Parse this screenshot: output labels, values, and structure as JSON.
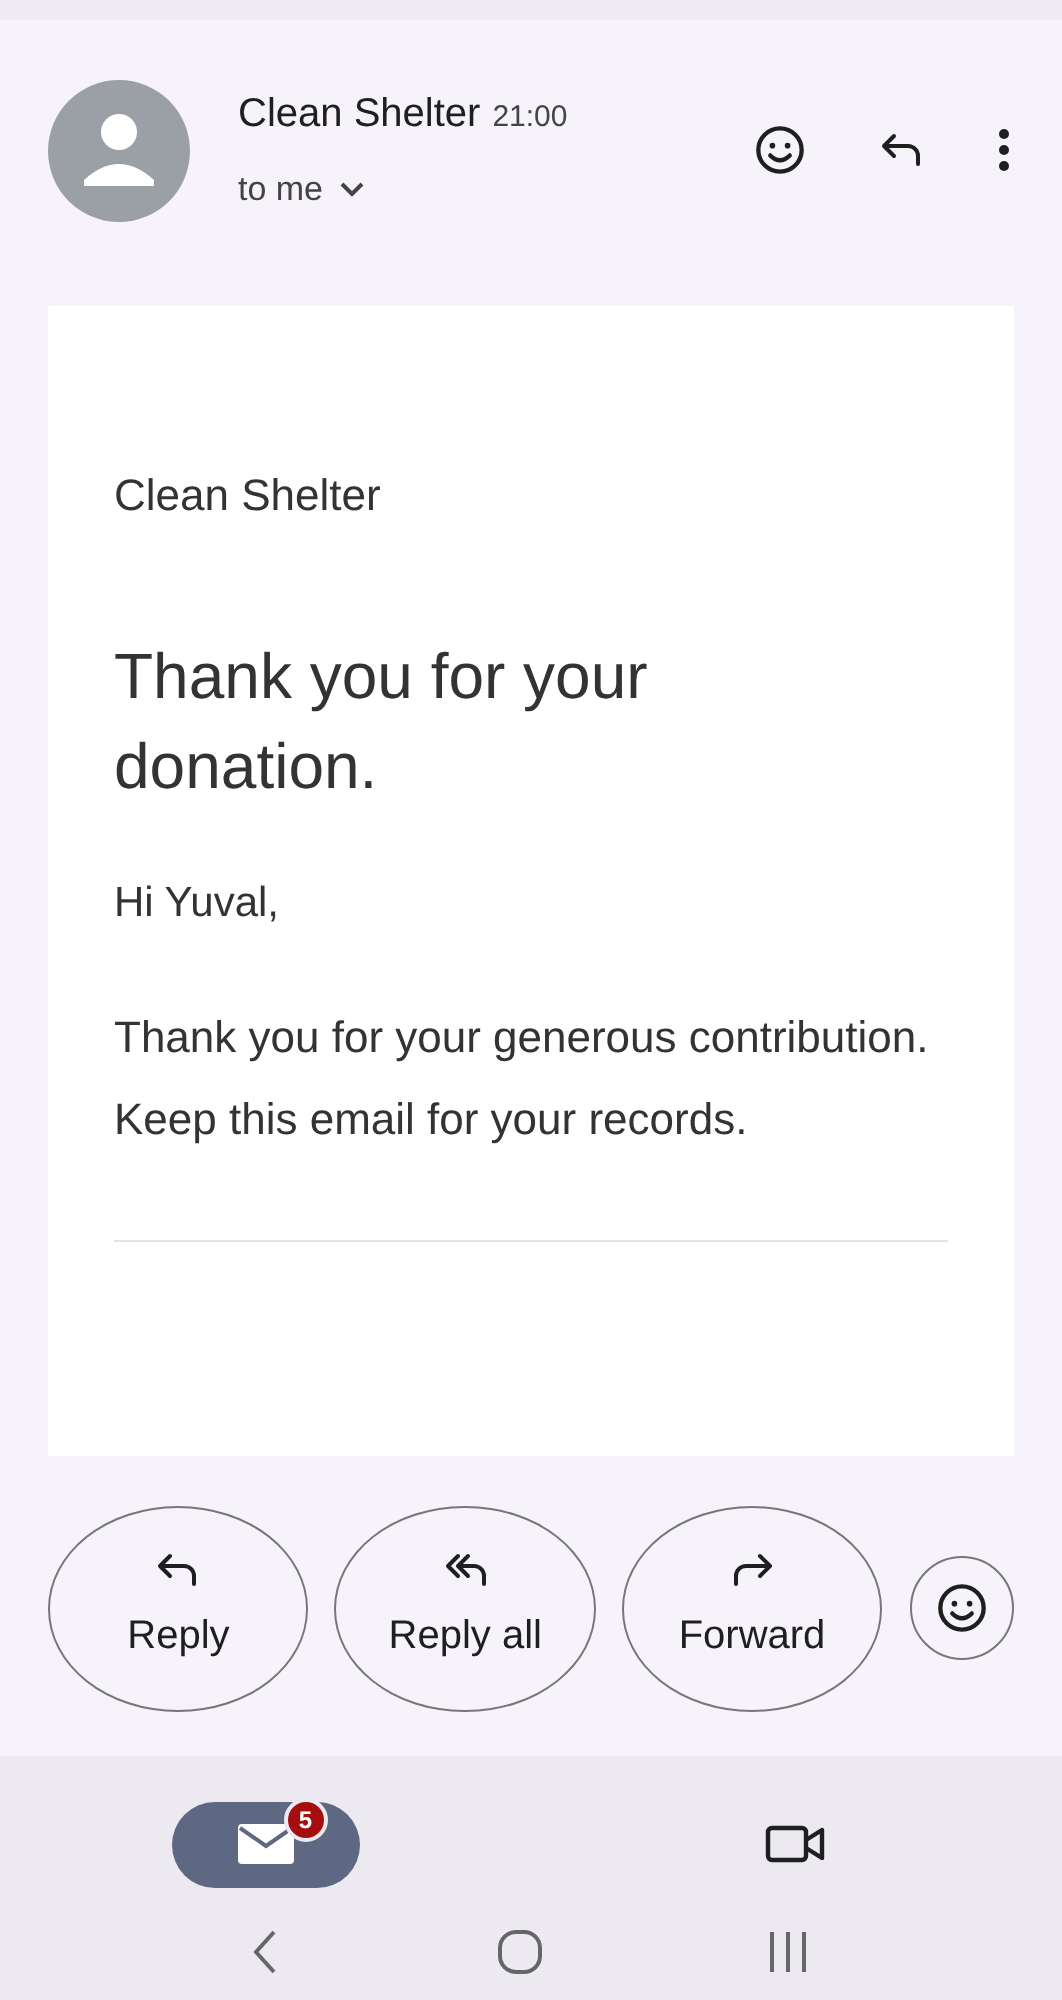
{
  "header": {
    "sender": "Clean Shelter",
    "time": "21:00",
    "recipient": "to me"
  },
  "message": {
    "org": "Clean Shelter",
    "heading": "Thank you for your donation.",
    "greeting": "Hi Yuval,",
    "body": "Thank you for your generous contribution. Keep this email for your records."
  },
  "actions": [
    {
      "kind": "reply",
      "label": "Reply"
    },
    {
      "kind": "reply-all",
      "label": "Reply all"
    },
    {
      "kind": "forward",
      "label": "Forward"
    },
    {
      "kind": "emoji"
    }
  ],
  "bottom_nav": [
    {
      "kind": "mail",
      "badge": "5",
      "selected": true
    },
    {
      "kind": "video",
      "selected": false
    }
  ]
}
